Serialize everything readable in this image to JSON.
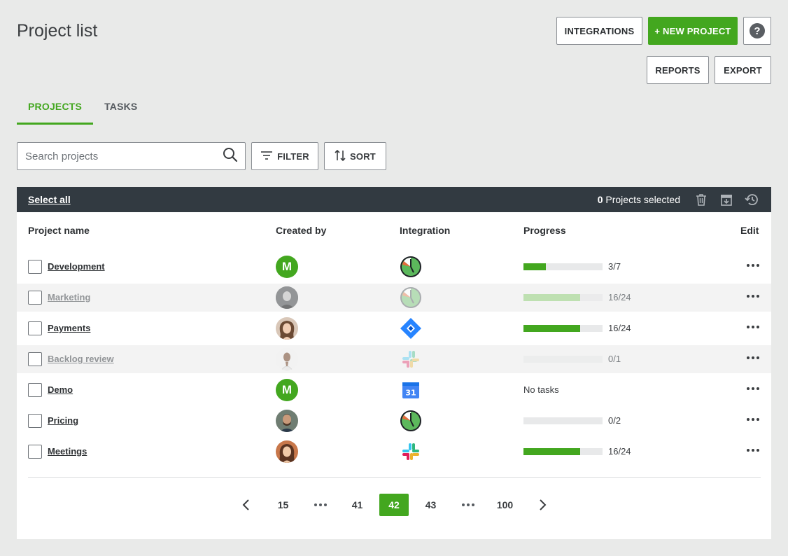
{
  "header": {
    "title": "Project list",
    "buttons": {
      "integrations": "INTEGRATIONS",
      "new_project": "+ NEW PROJECT",
      "help": "?",
      "reports": "REPORTS",
      "export": "EXPORT"
    }
  },
  "tabs": [
    {
      "label": "PROJECTS",
      "active": true
    },
    {
      "label": "TASKS",
      "active": false
    }
  ],
  "toolbar": {
    "search_placeholder": "Search projects",
    "filter_label": "FILTER",
    "sort_label": "SORT"
  },
  "selection_bar": {
    "select_all": "Select all",
    "count": "0",
    "count_suffix": " Projects selected"
  },
  "table": {
    "columns": {
      "project_name": "Project name",
      "created_by": "Created by",
      "integration": "Integration",
      "progress": "Progress",
      "edit": "Edit"
    },
    "rows": [
      {
        "name": "Development",
        "creator": "M",
        "integration": "clock-icon",
        "progress": 0.28,
        "ratio": "3/7",
        "dim": false
      },
      {
        "name": "Marketing",
        "creator": "photo",
        "integration": "clock-icon",
        "progress": 0.72,
        "ratio": "16/24",
        "dim": true
      },
      {
        "name": "Payments",
        "creator": "photo",
        "integration": "jira-icon",
        "progress": 0.72,
        "ratio": "16/24",
        "dim": false
      },
      {
        "name": "Backlog review",
        "creator": "photo",
        "integration": "slack-icon",
        "progress": 0,
        "ratio": "0/1",
        "dim": true
      },
      {
        "name": "Demo",
        "creator": "M",
        "integration": "calendar-icon",
        "calendar_day": "31",
        "progress": null,
        "ratio": "",
        "no_tasks": "No tasks",
        "dim": false
      },
      {
        "name": "Pricing",
        "creator": "photo",
        "integration": "clock-icon",
        "progress": 0,
        "ratio": "0/2",
        "dim": false
      },
      {
        "name": "Meetings",
        "creator": "photo",
        "integration": "slack-icon",
        "progress": 0.72,
        "ratio": "16/24",
        "dim": false
      }
    ]
  },
  "pagination": {
    "pages": [
      "15",
      "41",
      "42",
      "43",
      "100"
    ],
    "current": "42"
  },
  "colors": {
    "accent": "#43a71f",
    "bar_dark": "#323a41",
    "background": "#e9eae9"
  }
}
